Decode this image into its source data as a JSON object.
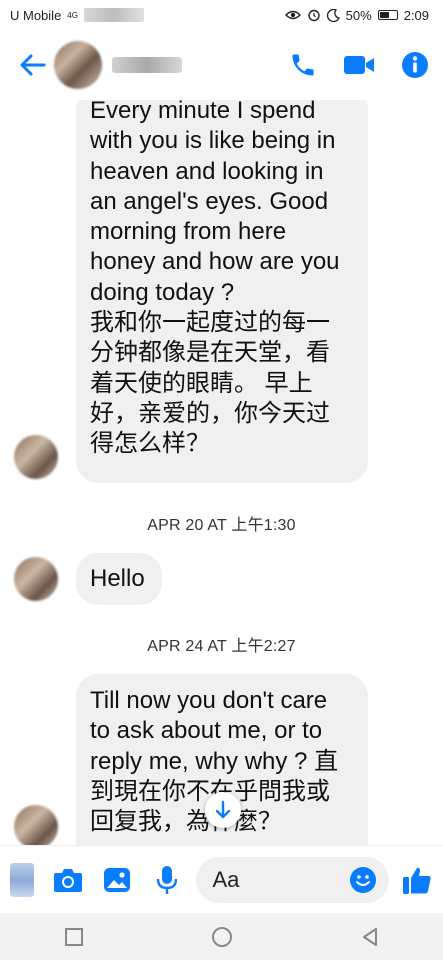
{
  "status_bar": {
    "carrier": "U Mobile",
    "network": "4G",
    "battery": "50%",
    "time": "2:09"
  },
  "header": {
    "contact_name_redacted": true,
    "actions": [
      "phone-icon",
      "video-icon",
      "info-icon"
    ]
  },
  "colors": {
    "accent": "#0a7cff",
    "bubble": "#f1f0f0"
  },
  "messages": [
    {
      "id": "m1",
      "lines": [
        "Every minute I spend",
        "with you is like being in",
        "heaven and looking in",
        "an angel's eyes. Good",
        "morning from here",
        "honey and how are you",
        "doing today ?",
        "我和你一起度过的每一",
        "分钟都像是在天堂，看",
        "着天使的眼睛。 早上",
        "好，亲爱的，你今天过",
        "得怎么样？"
      ]
    },
    {
      "id": "m2",
      "lines": [
        "Hello"
      ]
    },
    {
      "id": "m3",
      "lines": [
        "Till now you don't care",
        "to ask about me, or to",
        "reply me, why why ? 直",
        "到現在你不在乎問我或",
        "回复我，為什麼？"
      ]
    }
  ],
  "timestamps": [
    "APR 20 AT 上午1:30",
    "APR 24 AT 上午2:27"
  ],
  "composer": {
    "placeholder": "Aa",
    "icons": [
      "menu-icon",
      "camera-icon",
      "gallery-icon",
      "microphone-icon",
      "emoji-icon",
      "thumbs-up-icon"
    ]
  },
  "nav_bar": [
    "recent-apps-icon",
    "home-icon",
    "back-icon"
  ]
}
